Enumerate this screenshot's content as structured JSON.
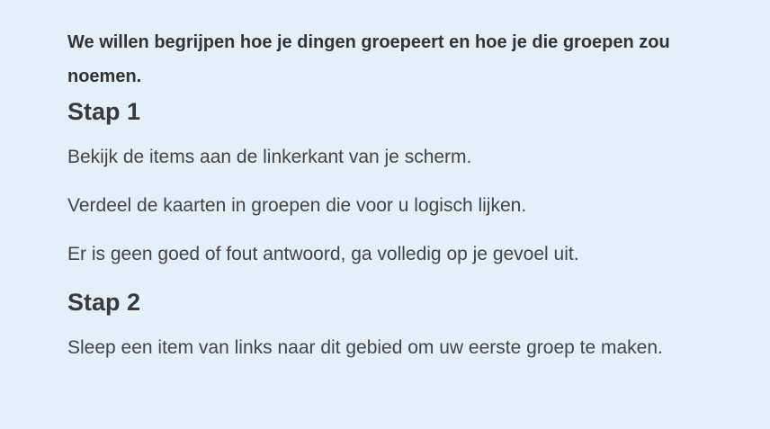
{
  "instructions": {
    "intro": "We willen begrijpen hoe je dingen groepeert en hoe je die groepen zou noemen.",
    "step1": {
      "heading": "Stap 1",
      "paragraphs": [
        "Bekijk de items aan de linkerkant van je scherm.",
        "Verdeel de kaarten in groepen die voor u logisch lijken.",
        "Er is geen goed of fout antwoord, ga volledig op je gevoel uit."
      ]
    },
    "step2": {
      "heading": "Stap 2",
      "paragraphs": [
        "Sleep een item van links naar dit gebied om uw eerste groep te maken."
      ]
    }
  },
  "colors": {
    "background": "#e3eff9",
    "text": "#444444"
  }
}
